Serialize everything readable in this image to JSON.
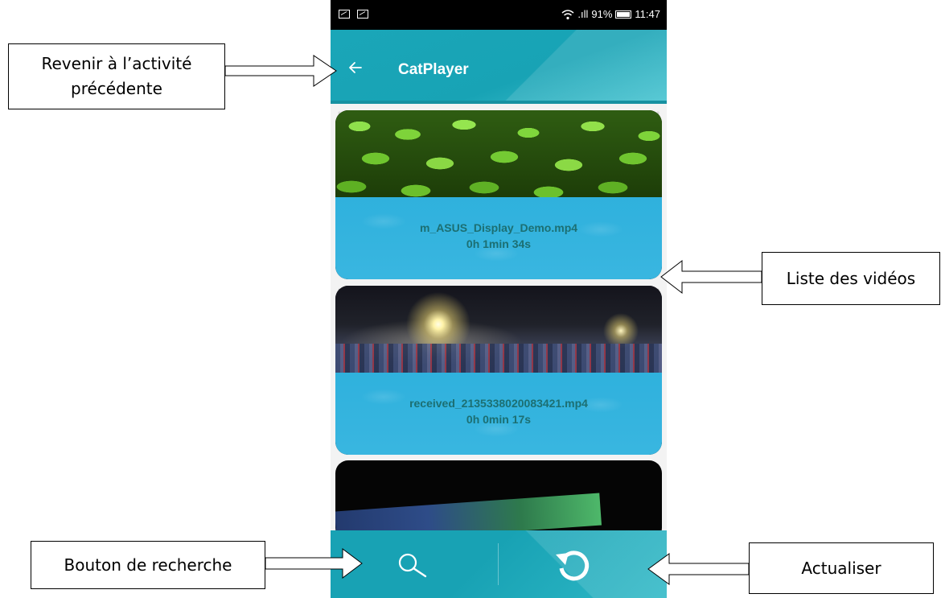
{
  "status_bar": {
    "signal": ".ıll",
    "battery": "91%",
    "time": "11:47"
  },
  "app_bar": {
    "title": "CatPlayer",
    "back_icon": "arrow-left-icon"
  },
  "videos": [
    {
      "name": "m_ASUS_Display_Demo.mp4",
      "duration": "0h 1min 34s"
    },
    {
      "name": "received_2135338020083421.mp4",
      "duration": "0h 0min 17s"
    }
  ],
  "bottom_bar": {
    "search_icon": "search-icon",
    "refresh_icon": "refresh-icon"
  },
  "annotations": {
    "back_line1": "Revenir à l’activité",
    "back_line2": "précédente",
    "list": "Liste des vidéos",
    "search": "Bouton de recherche",
    "refresh": "Actualiser"
  },
  "colors": {
    "accent": "#18a3b5",
    "overlay": "#35b4df",
    "overlay_text": "#1c6f72"
  }
}
